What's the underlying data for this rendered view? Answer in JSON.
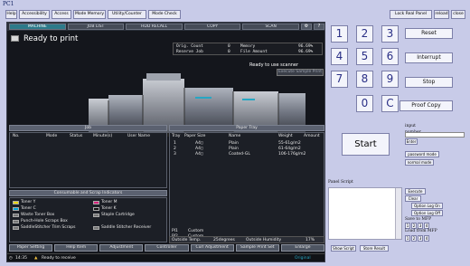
{
  "window": {
    "title": "PC1"
  },
  "top_buttons": [
    "Help",
    "Accessibility",
    "Access",
    "Mode Memory",
    "Utility/Counter",
    "Mode Check"
  ],
  "top_right_buttons": [
    "Lock Real Panel",
    "reload",
    "close"
  ],
  "machine": {
    "tabs": [
      "MACHINE",
      "JOB LIST",
      "HDD RECALL",
      "COPY",
      "SCAN"
    ],
    "status_title": "Ready to print",
    "counters": [
      {
        "label": "Orig. Count",
        "value": "0",
        "label2": "Memory",
        "value2": "96.69%"
      },
      {
        "label": "Reserve Job",
        "value": "0",
        "label2": "File Amount",
        "value2": "96.69%"
      }
    ],
    "scanner_status": "Ready to use scanner",
    "sample_print": "Execute Sample Print"
  },
  "job_section": {
    "header": "Job",
    "columns": [
      "No.",
      "Mode",
      "Status",
      "Minute(s)",
      "User Name"
    ]
  },
  "paper_tray": {
    "header": "Paper Tray",
    "columns": [
      "Tray",
      "Paper Size",
      "Name",
      "Weight",
      "Amount"
    ],
    "rows": [
      {
        "tray": "1",
        "size": "A4▯",
        "name": "Plain",
        "weight": "55-61g/m2"
      },
      {
        "tray": "2",
        "size": "A4▯",
        "name": "Plain",
        "weight": "61-64g/m2"
      },
      {
        "tray": "3",
        "size": "A4▯",
        "name": "Coated-GL",
        "weight": "106-176g/m2"
      }
    ],
    "pi_rows": [
      {
        "tray": "PI1",
        "name": "Custom"
      },
      {
        "tray": "PI2",
        "name": "Custom"
      }
    ],
    "outside_temp_label": "Outside Temp.",
    "outside_temp_value": "25degrees",
    "outside_humidity_label": "Outside Humidity",
    "outside_humidity_value": "17%"
  },
  "consumables": {
    "header": "Consumable and Scrap Indicators",
    "items_left": [
      "Toner Y",
      "Toner C",
      "Waste Toner Box",
      "Punch-Hole Scraps Box",
      "SaddleStitcher Trim Scraps"
    ],
    "items_right": [
      "Toner M",
      "Toner K",
      "Staple Cartridge",
      "",
      "Saddle Stitcher Receiver"
    ]
  },
  "bottom_buttons": [
    "Paper Setting",
    "Help Item",
    "Adjustment",
    "Controller",
    "Curl Adjustment",
    "Sample Print Set",
    "Enlarge"
  ],
  "statusbar": {
    "time": "14:35",
    "message": "Ready to receive",
    "right": "Original"
  },
  "keypad": {
    "keys": [
      "1",
      "2",
      "3",
      "4",
      "5",
      "6",
      "7",
      "8",
      "9",
      "0",
      "C"
    ],
    "controls": [
      "Reset",
      "Interrupt",
      "Stop",
      "Proof Copy"
    ],
    "start": "Start"
  },
  "input_panel": {
    "input_label": "input",
    "number_label": "number",
    "enter_btn": "Enter",
    "password_btn": "password mode",
    "normal_btn": "normal mode"
  },
  "script_panel": {
    "label": "Panel Script",
    "execute": "Execute",
    "clear": "Clear",
    "option_log_on": "Option Log On",
    "option_log_off": "Option Log Off",
    "save_to_mfp": "Save to MFP",
    "load_from_mfp": "Load from MFP",
    "slots": [
      "1",
      "2",
      "3",
      "4"
    ],
    "show_script": "Show Script",
    "store_result": "Store Result"
  }
}
